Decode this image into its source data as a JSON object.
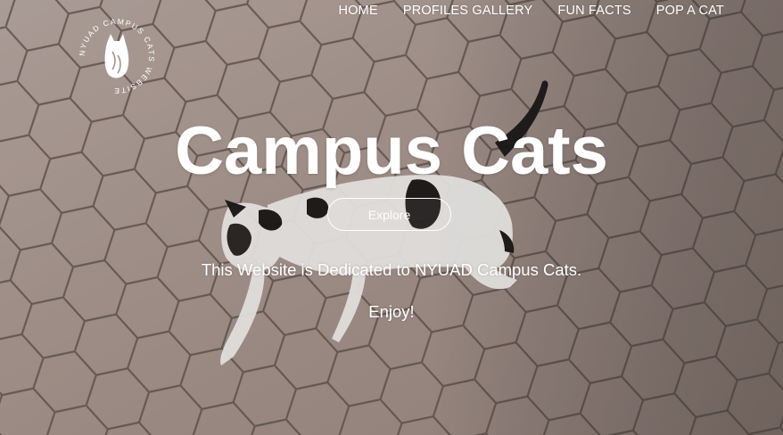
{
  "site": {
    "logo_text": "NYUAD CAMPUS CATS WEBSITE",
    "logo_icon": "cat-silhouette-icon"
  },
  "nav": {
    "items": [
      {
        "label": "HOME"
      },
      {
        "label": "PROFILES GALLERY"
      },
      {
        "label": "FUN FACTS"
      },
      {
        "label": "POP A CAT"
      }
    ]
  },
  "hero": {
    "title": "Campus Cats",
    "button_label": "Explore",
    "dedication": "This Website is Dedicated to NYUAD Campus Cats.",
    "enjoy": "Enjoy!",
    "background": "photo of a white-and-black cat walking on hexagonal paving tiles"
  },
  "colors": {
    "text": "#ffffff",
    "pavement": "#a7958c",
    "grout": "#5a4d47"
  }
}
